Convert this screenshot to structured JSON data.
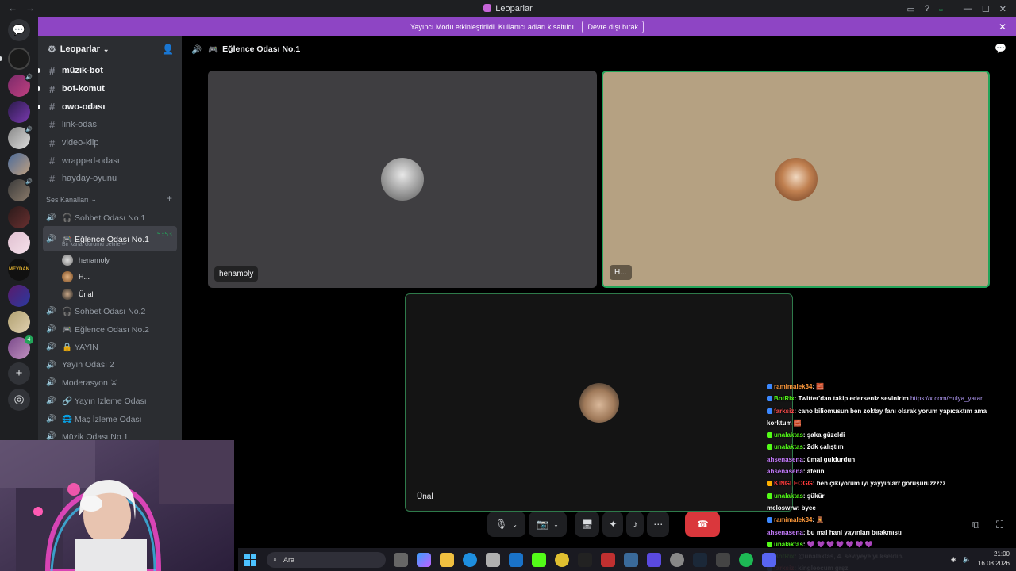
{
  "window": {
    "title": "Leoparlar"
  },
  "banner": {
    "message": "Yayıncı Modu etkinleştirildi. Kullanıcı adları kısaltıldı.",
    "button": "Devre dışı bırak"
  },
  "server": {
    "name": "Leoparlar"
  },
  "text_channels": [
    {
      "name": "müzik-bot",
      "unread": true
    },
    {
      "name": "bot-komut",
      "unread": true
    },
    {
      "name": "owo-odası",
      "unread": true
    },
    {
      "name": "link-odası",
      "unread": false
    },
    {
      "name": "video-klip",
      "unread": false
    },
    {
      "name": "wrapped-odası",
      "unread": false
    },
    {
      "name": "hayday-oyunu",
      "unread": false
    }
  ],
  "voice_category": "Ses Kanalları",
  "voice_channels_top": [
    {
      "name": "🎧 Sohbet Odası No.1"
    }
  ],
  "active_voice": {
    "name": "🎮 Eğlence Odası No.1",
    "timer": "5:53",
    "status": "Bir kanal durumu belirle ✏"
  },
  "voice_users": [
    {
      "name": "henamoly"
    },
    {
      "name": "H..."
    },
    {
      "name": "Ünal"
    }
  ],
  "voice_channels_bottom": [
    {
      "name": "🎧 Sohbet Odası No.2"
    },
    {
      "name": "🎮 Eğlence Odası No.2"
    },
    {
      "name": "🔒 YAYIN"
    },
    {
      "name": "Yayın Odası 2"
    },
    {
      "name": "Moderasyon ⚔"
    },
    {
      "name": "🔗 Yayın İzleme Odası"
    },
    {
      "name": "🌐 Maç İzleme Odası"
    },
    {
      "name": "Müzik Odası No.1"
    }
  ],
  "stage": {
    "channel": "Eğlence Odası No.1",
    "tiles": [
      {
        "label": "henamoly"
      },
      {
        "label": "H..."
      },
      {
        "label": "Ünal"
      }
    ]
  },
  "chat_overlay": [
    {
      "user": "ramimalek34",
      "text": ": 🧱",
      "color": "#ff9a3c",
      "badge": "#3b88ff"
    },
    {
      "user": "BotRix",
      "text": ": Twitter'dan takip ederseniz sevinirim ",
      "link": "https://x.com/Hulya_yarar",
      "color": "#53fc18",
      "badge": "#3b88ff"
    },
    {
      "user": "farksiz",
      "text": ": cano biliomusun ben zoktay fanı olarak yorum yapıcaktım ama",
      "color": "#ff4d4d",
      "badge": "#3b88ff"
    },
    {
      "user": "",
      "text": "korktum 🧱",
      "color": "#fff",
      "badge": ""
    },
    {
      "user": "unalaktas",
      "text": ": şaka güzeldi",
      "color": "#53fc18",
      "badge": "#53fc18"
    },
    {
      "user": "unalaktas",
      "text": ": 2dk çalıştım",
      "color": "#53fc18",
      "badge": "#53fc18"
    },
    {
      "user": "ahsenasena",
      "text": ": ümal guldurdun",
      "color": "#c77dff",
      "badge": ""
    },
    {
      "user": "ahsenasena",
      "text": ": aferin",
      "color": "#c77dff",
      "badge": ""
    },
    {
      "user": "KINGLEOGG",
      "text": ": ben çıkıyorum iyi yayyınlarr görüşürüzzzzz",
      "color": "#ff3b3b",
      "badge": "#ffb000"
    },
    {
      "user": "unalaktas",
      "text": ": şükür",
      "color": "#53fc18",
      "badge": "#53fc18"
    },
    {
      "user": "meloswrw",
      "text": ": byee",
      "color": "#ffffff",
      "badge": ""
    },
    {
      "user": "ramimalek34",
      "text": ": 🧸",
      "color": "#ff9a3c",
      "badge": "#3b88ff"
    },
    {
      "user": "ahsenasena",
      "text": ": bu mal hani yayınları bırakmıstı",
      "color": "#c77dff",
      "badge": ""
    },
    {
      "user": "unalaktas",
      "text": ": 💜 💜 💜 💜 💜 💜 💜",
      "color": "#53fc18",
      "badge": "#53fc18"
    },
    {
      "user": "BotRix",
      "text": ": @unalaktas, 4. seviyeye yükseldin.",
      "color": "#53fc18",
      "badge": "#3b88ff"
    },
    {
      "user": "farksiz",
      "text": ": kingleocum grşz",
      "color": "#ff4d4d",
      "badge": "#3b88ff"
    }
  ],
  "taskbar": {
    "search": "Ara",
    "time": "21:00",
    "date": "16.08.2026"
  },
  "colors": {
    "accent": "#8e45c4",
    "speaking": "#23a55a",
    "end_call": "#da373c"
  }
}
